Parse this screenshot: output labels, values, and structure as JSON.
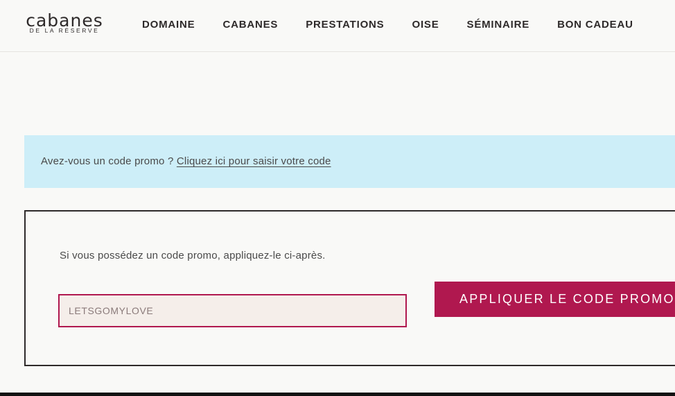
{
  "brand": {
    "name": "cabanes",
    "tagline": "DE LA RÉSERVE"
  },
  "nav": {
    "items": [
      {
        "label": "DOMAINE"
      },
      {
        "label": "CABANES"
      },
      {
        "label": "PRESTATIONS"
      },
      {
        "label": "OISE"
      },
      {
        "label": "SÉMINAIRE"
      },
      {
        "label": "BON CADEAU"
      }
    ]
  },
  "promo_banner": {
    "question": "Avez-vous un code promo ?",
    "link_label": "Cliquez ici pour saisir votre code"
  },
  "coupon_form": {
    "intro": "Si vous possédez un code promo, appliquez-le ci-après.",
    "input_value": "LETSGOMYLOVE",
    "apply_label": "APPLIQUER LE CODE PROMO"
  },
  "colors": {
    "background": "#f9f9f7",
    "banner": "#cdeef8",
    "accent": "#b0184f",
    "text": "#2e2a2a"
  }
}
